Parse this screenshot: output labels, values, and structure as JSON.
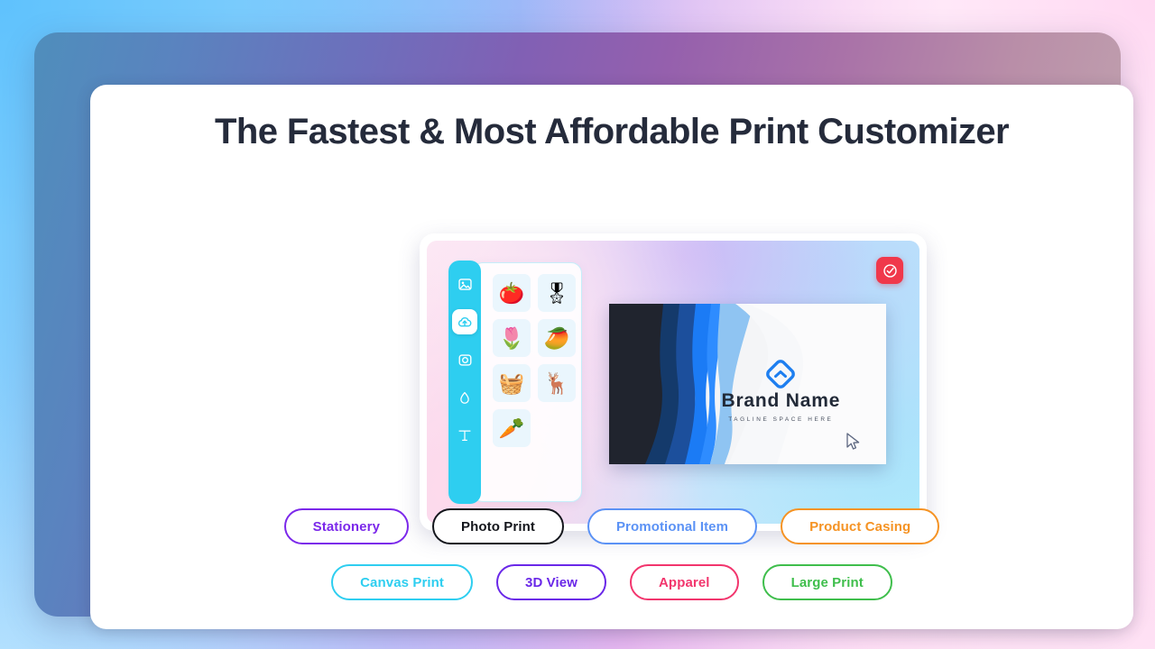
{
  "page": {
    "title": "The Fastest & Most Affordable Print Customizer"
  },
  "editor": {
    "toolbar": [
      {
        "icon": "image-icon",
        "name": "tool-image",
        "active": false
      },
      {
        "icon": "cloud-upload-icon",
        "name": "tool-upload",
        "active": true
      },
      {
        "icon": "camera-icon",
        "name": "tool-camera",
        "active": false
      },
      {
        "icon": "droplet-icon",
        "name": "tool-color",
        "active": false
      },
      {
        "icon": "text-icon",
        "name": "tool-text",
        "active": false
      }
    ],
    "stickers": [
      {
        "name": "sticker-cherries",
        "glyph": "🍅"
      },
      {
        "name": "sticker-badge",
        "glyph": "🎖"
      },
      {
        "name": "sticker-tulip",
        "glyph": "🌷"
      },
      {
        "name": "sticker-papaya",
        "glyph": "🥭"
      },
      {
        "name": "sticker-easter-basket",
        "glyph": "🧺"
      },
      {
        "name": "sticker-moose",
        "glyph": "🦌"
      },
      {
        "name": "sticker-carrot",
        "glyph": "🥕"
      }
    ],
    "artboard": {
      "brand_name": "Brand Name",
      "tagline": "TAGLINE SPACE HERE",
      "logo_color": "#1e7ff0",
      "dark_panel_color": "#20242e",
      "accent_blue": "#1b7bf5"
    },
    "confirm_button": {
      "icon": "check-circle-icon",
      "color": "#f0384b"
    },
    "accent_color": "#2ecef0"
  },
  "categories_row_1": [
    {
      "label": "Stationery",
      "color": "#7b28ea"
    },
    {
      "label": "Photo Print",
      "color": "#14161c"
    },
    {
      "label": "Promotional Item",
      "color": "#5b92f5"
    },
    {
      "label": "Product Casing",
      "color": "#f59324"
    }
  ],
  "categories_row_2": [
    {
      "label": "Canvas Print",
      "color": "#2ecef0"
    },
    {
      "label": "3D View",
      "color": "#6a28e8"
    },
    {
      "label": "Apparel",
      "color": "#f2356d"
    },
    {
      "label": "Large Print",
      "color": "#3fbe4c"
    }
  ]
}
